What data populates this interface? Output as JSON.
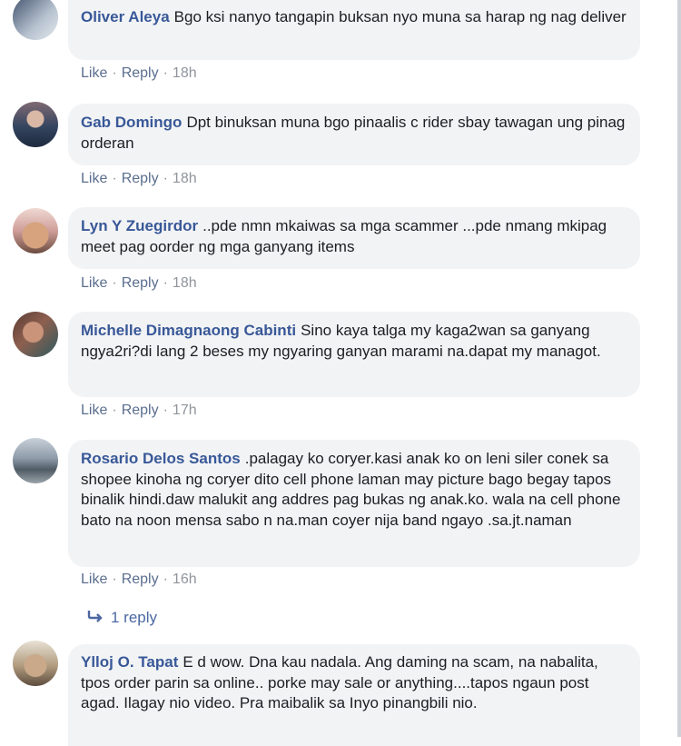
{
  "comments": [
    {
      "author": "Oliver Aleya",
      "text": "Bgo ksi nanyo tangapin buksan nyo muna sa harap ng nag deliver",
      "like": "Like",
      "reply": "Reply",
      "time": "18h"
    },
    {
      "author": "Gab Domingo",
      "text": "Dpt binuksan muna bgo pinaalis c rider sbay tawagan ung pinag orderan",
      "like": "Like",
      "reply": "Reply",
      "time": "18h"
    },
    {
      "author": "Lyn Y Zuegirdor",
      "text": "..pde nmn mkaiwas sa mga scammer ...pde nmang mkipag meet pag oorder ng mga ganyang items",
      "like": "Like",
      "reply": "Reply",
      "time": "18h"
    },
    {
      "author": "Michelle Dimagnaong Cabinti",
      "text": "Sino kaya talga my kaga2wan sa ganyang ngya2ri?di lang 2 beses my ngyaring ganyan marami na.dapat my managot.",
      "like": "Like",
      "reply": "Reply",
      "time": "17h"
    },
    {
      "author": "Rosario Delos Santos",
      "text": ".palagay ko coryer.kasi anak ko on leni siler conek sa shopee kinoha ng coryer dito cell phone laman may picture bago begay tapos binalik hindi.daw malukit ang addres pag bukas ng anak.ko. wala na cell phone bato na noon mensa sabo n na.man coyer nija band ngayo .sa.jt.naman",
      "like": "Like",
      "reply": "Reply",
      "time": "16h"
    },
    {
      "author": "Ylloj O. Tapat",
      "text": "E d wow. Dna kau nadala. Ang daming na scam, na nabalita, tpos order parin sa online.. porke may sale or anything....tapos ngaun post agad. Ilagay nio video. Pra maibalik sa Inyo pinangbili nio."
    }
  ],
  "replies_link": "1 reply",
  "colors": {
    "author": "#385898",
    "bubble": "#f2f3f5",
    "link": "#5b6e8f",
    "time": "#90949c"
  }
}
